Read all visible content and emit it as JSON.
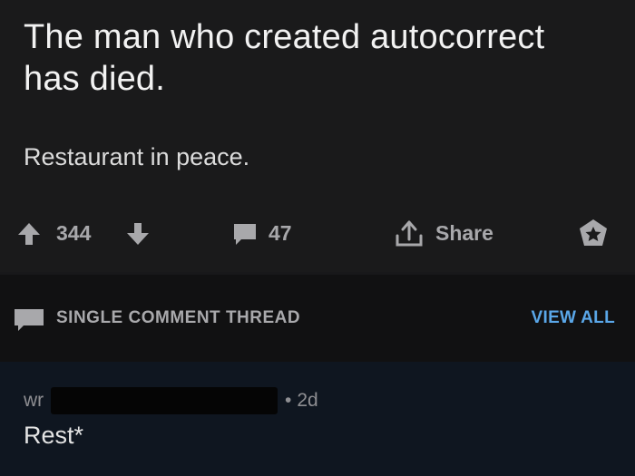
{
  "post": {
    "title": "The man who created autocorrect has died.",
    "body": "Restaurant in peace.",
    "upvotes": "344",
    "comments": "47",
    "share_label": "Share"
  },
  "thread": {
    "title": "SINGLE COMMENT THREAD",
    "view_all": "VIEW ALL"
  },
  "comment": {
    "author_visible": "wr",
    "age": "2d",
    "text": "Rest*"
  },
  "colors": {
    "background": "#1a1a1b",
    "header_background": "#111112",
    "comment_background": "#0f1620",
    "muted_text": "#a8a8ab",
    "link_blue": "#5aa7e8"
  },
  "icons": [
    "upvote-arrow-icon",
    "downvote-arrow-icon",
    "comment-bubble-icon",
    "share-icon",
    "award-icon"
  ]
}
